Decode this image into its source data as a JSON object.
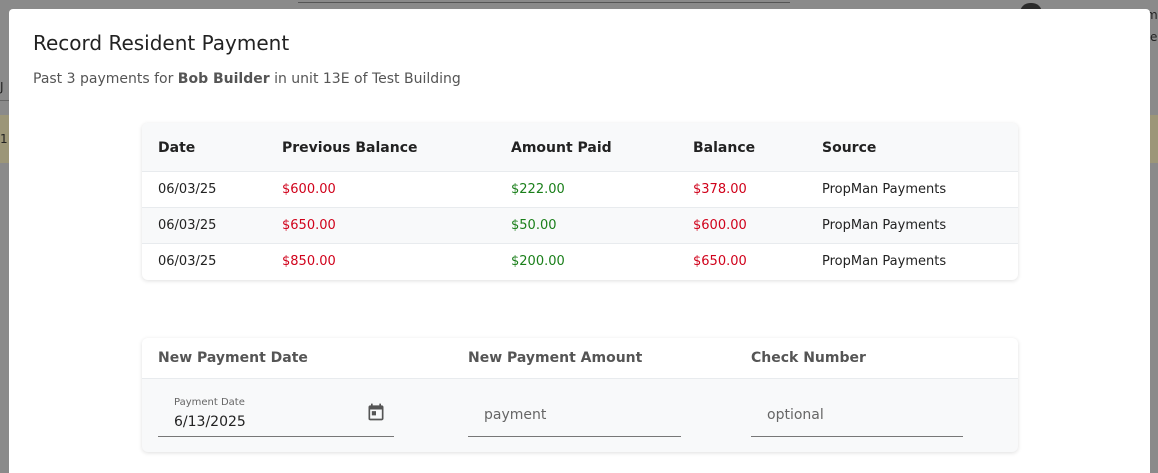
{
  "background": {
    "text_a": "m",
    "text_b": "e",
    "left_a": "J",
    "left_b": "1"
  },
  "modal": {
    "title": "Record Resident Payment",
    "subtitle": {
      "prefix": "Past 3 payments for ",
      "resident": "Bob Builder",
      "middle": " in unit ",
      "unit": "13E",
      "of": " of ",
      "building": "Test Building"
    }
  },
  "payments_table": {
    "headers": [
      "Date",
      "Previous Balance",
      "Amount Paid",
      "Balance",
      "Source"
    ],
    "rows": [
      [
        "06/03/25",
        "$600.00",
        "$222.00",
        "$378.00",
        "PropMan Payments"
      ],
      [
        "06/03/25",
        "$650.00",
        "$50.00",
        "$600.00",
        "PropMan Payments"
      ],
      [
        "06/03/25",
        "$850.00",
        "$200.00",
        "$650.00",
        "PropMan Payments"
      ]
    ]
  },
  "new_payment": {
    "headers": [
      "New Payment Date",
      "New Payment Amount",
      "Check Number"
    ],
    "date_label": "Payment Date",
    "date_value": "6/13/2025",
    "amount_placeholder": "payment",
    "check_placeholder": "optional"
  },
  "colors": {
    "negative": "#d0021b",
    "positive": "#1a7f1a",
    "overlay": "#8a8a8a"
  },
  "icons": {
    "date_picker": "calendar-icon"
  }
}
